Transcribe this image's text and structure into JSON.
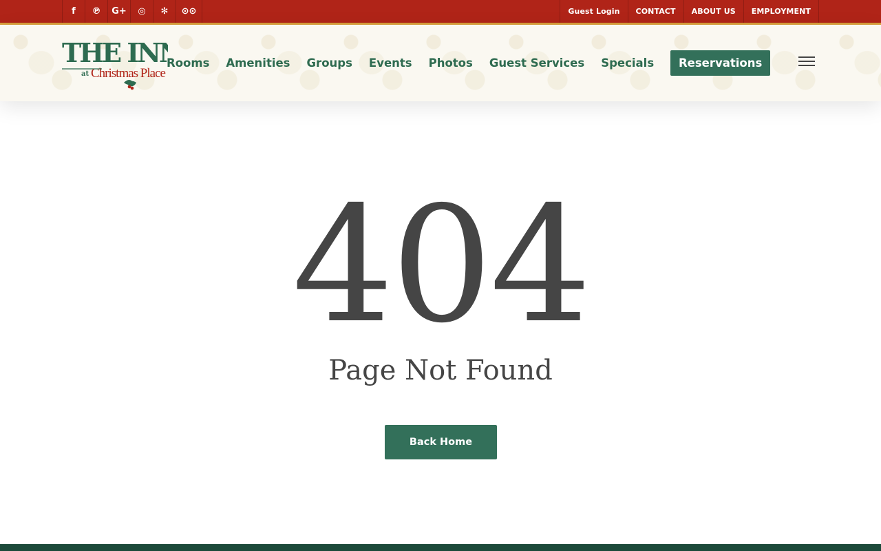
{
  "topbar": {
    "social": [
      {
        "icon": "facebook-icon",
        "glyph": "f"
      },
      {
        "icon": "pinterest-icon",
        "glyph": "℗"
      },
      {
        "icon": "google-plus-icon",
        "glyph": "G+"
      },
      {
        "icon": "instagram-icon",
        "glyph": "◎"
      },
      {
        "icon": "yelp-icon",
        "glyph": "✻"
      },
      {
        "icon": "tripadvisor-icon",
        "glyph": "⊙⊙"
      }
    ],
    "links": [
      "Guest Login",
      "CONTACT",
      "ABOUT US",
      "EMPLOYMENT"
    ]
  },
  "header": {
    "logo": {
      "line1": "THE INN",
      "line2": "at",
      "line3": "Christmas Place"
    },
    "nav": [
      "Rooms",
      "Amenities",
      "Groups",
      "Events",
      "Photos",
      "Guest Services",
      "Specials"
    ],
    "cta": "Reservations"
  },
  "main": {
    "code": "404",
    "title": "Page Not Found",
    "button": "Back Home"
  },
  "colors": {
    "topbar": "#b02418",
    "accent_green": "#33705a",
    "nav_green": "#2e6b50",
    "text_dark": "#454545",
    "footer": "#1c4a3a"
  }
}
